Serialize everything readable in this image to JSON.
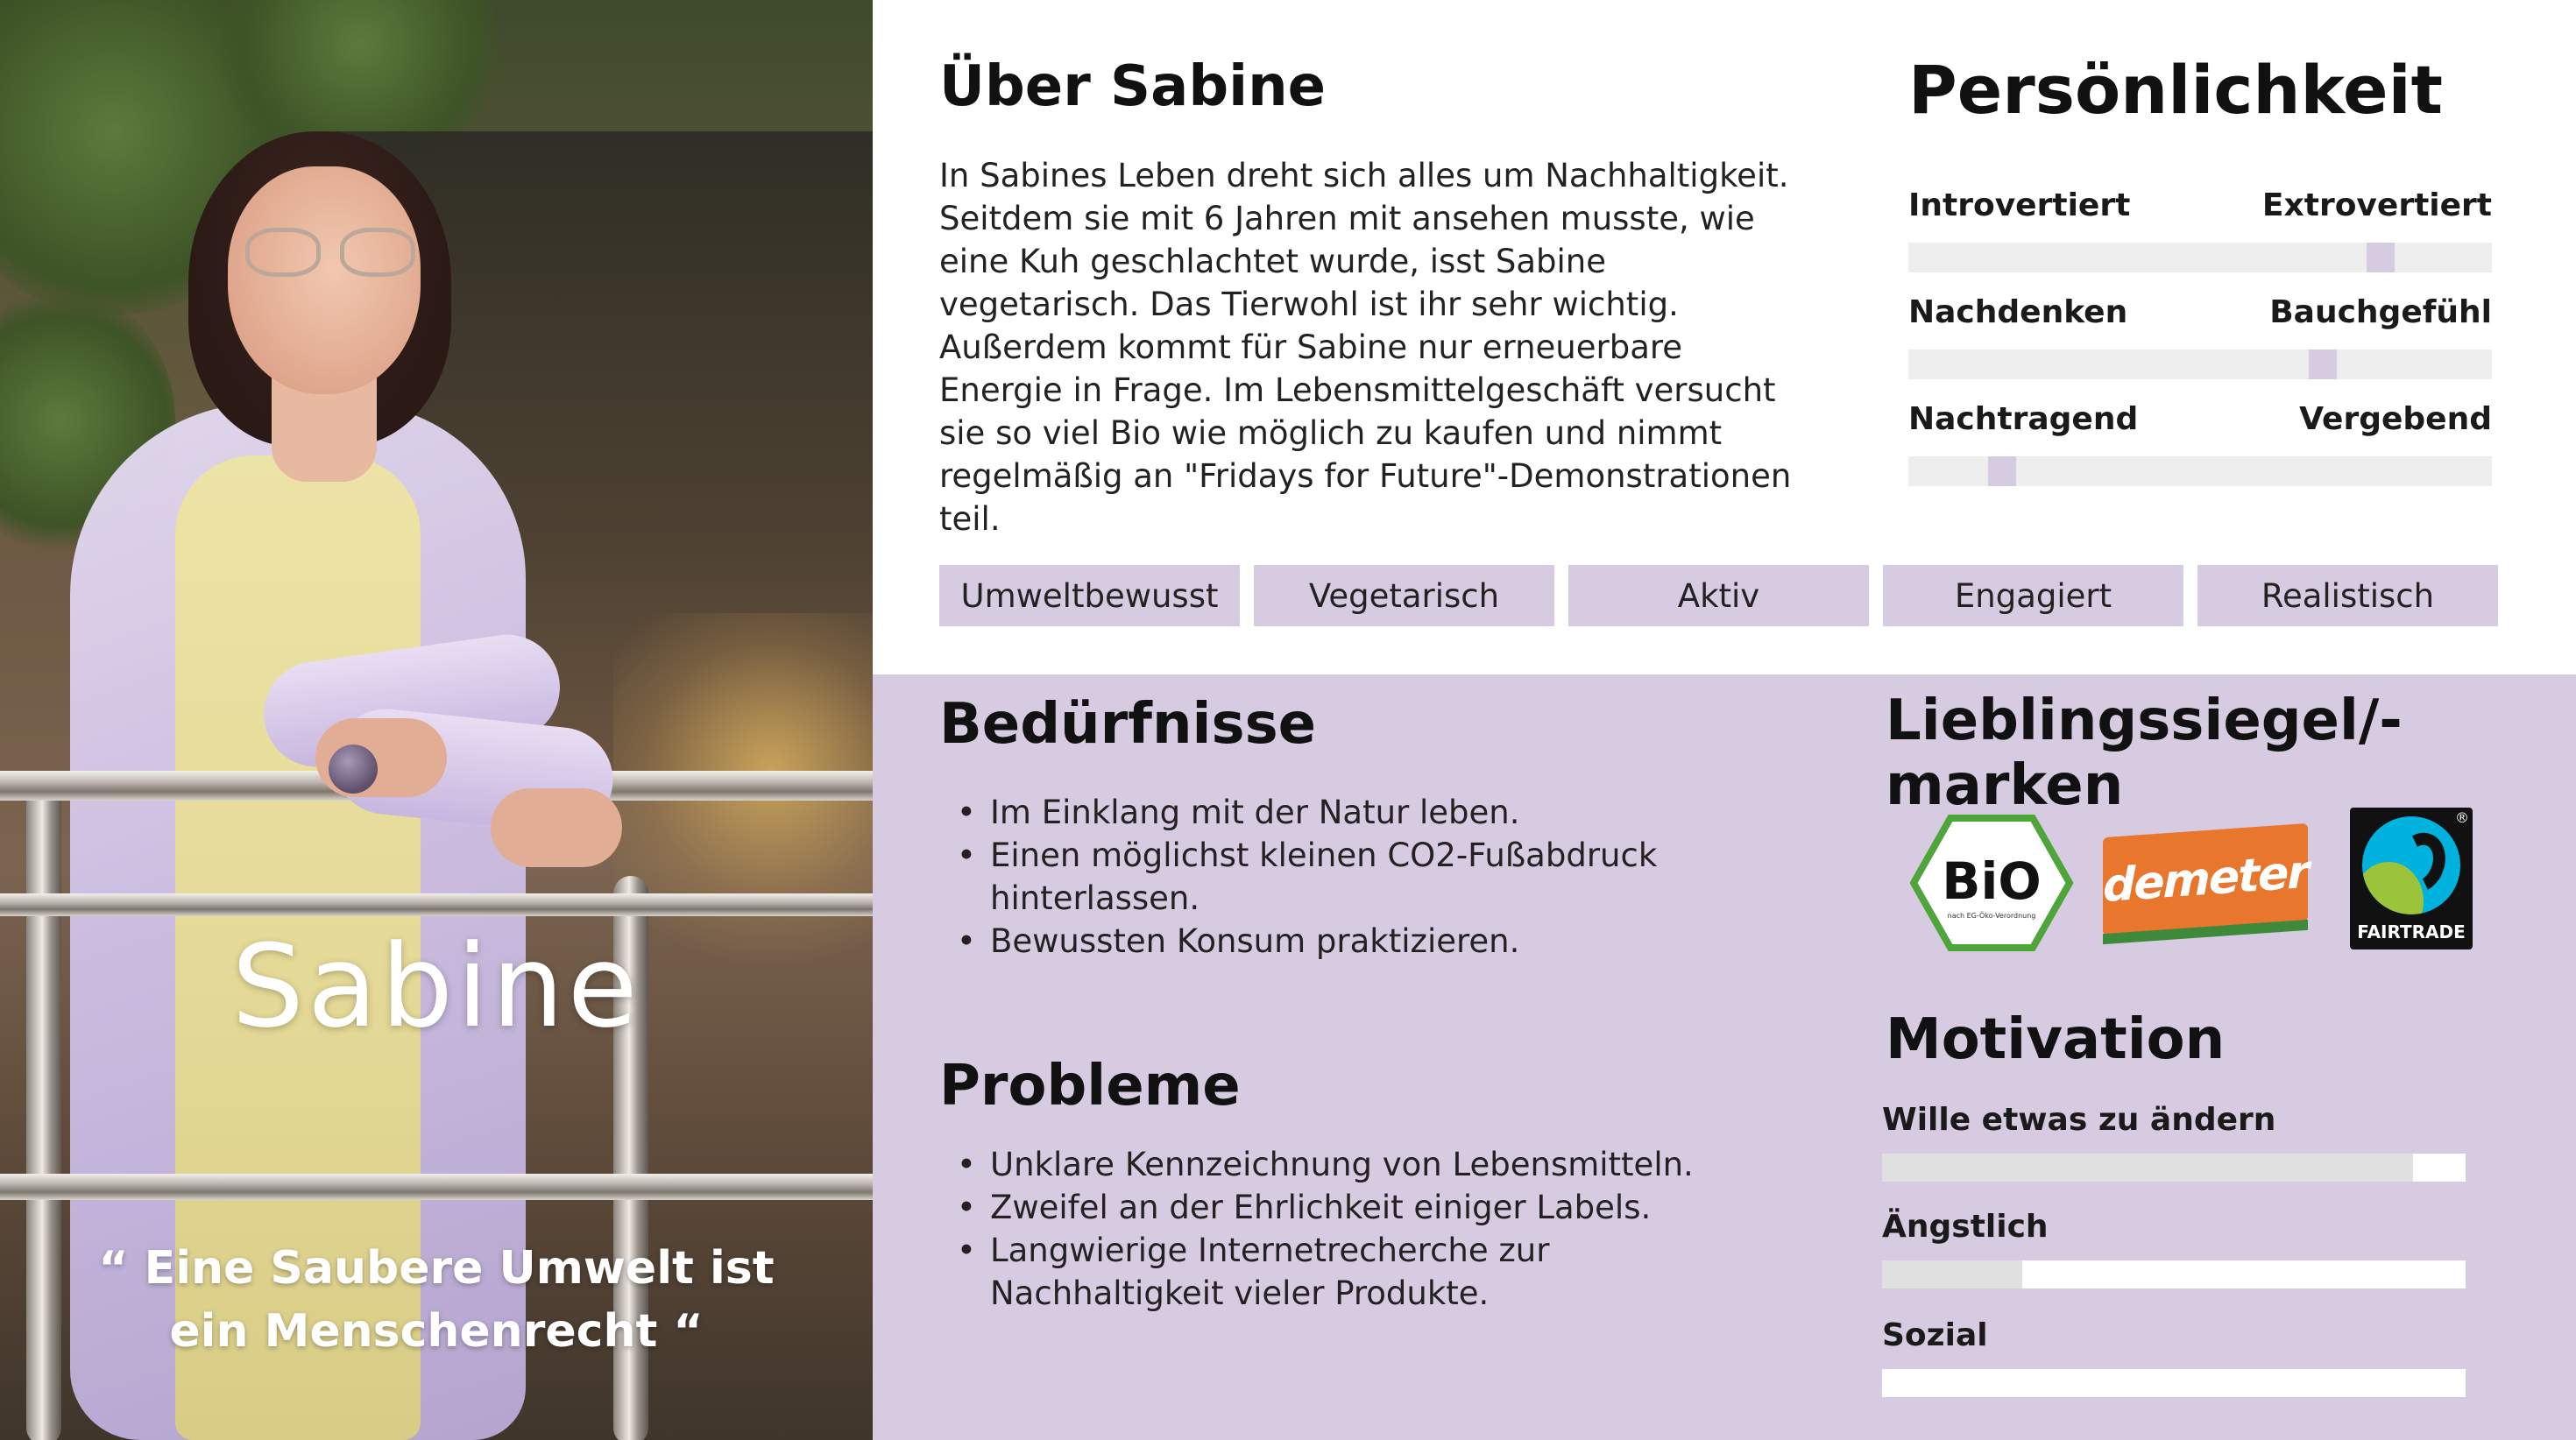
{
  "persona": {
    "name": "Sabine",
    "quote": "“ Eine Saubere Umwelt ist ein Menschenrecht “"
  },
  "about": {
    "title": "Über Sabine",
    "text": "In Sabines Leben dreht sich alles um Nachhaltigkeit. Seitdem sie mit 6 Jahren mit ansehen musste, wie eine Kuh geschlachtet wurde, isst Sabine vegetarisch. Das Tierwohl ist ihr sehr wichtig. Außerdem kommt für Sabine nur erneuerbare Energie in Frage. Im Lebensmittelgeschäft versucht sie so viel Bio wie möglich zu kaufen und nimmt regelmäßig an \"Fridays for Future\"-Demonstrationen teil."
  },
  "personality": {
    "title": "Persönlichkeit",
    "traits": [
      {
        "left": "Introvertiert",
        "right": "Extrovertiert",
        "value": 0.81
      },
      {
        "left": "Nachdenken",
        "right": "Bauchgefühl",
        "value": 0.71
      },
      {
        "left": "Nachtragend",
        "right": "Vergebend",
        "value": 0.16
      }
    ]
  },
  "tags": [
    "Umweltbewusst",
    "Vegetarisch",
    "Aktiv",
    "Engagiert",
    "Realistisch"
  ],
  "needs": {
    "title": "Bedürfnisse",
    "items": [
      "Im Einklang mit der Natur leben.",
      "Einen möglichst kleinen CO2-Fußabdruck hinterlassen.",
      "Bewussten Konsum praktizieren."
    ]
  },
  "problems": {
    "title": "Probleme",
    "items": [
      "Unklare Kennzeichnung von Lebensmitteln.",
      "Zweifel an der Ehrlichkeit einiger Labels.",
      "Langwierige Internetrecherche zur Nachhaltigkeit vieler Produkte."
    ]
  },
  "brands": {
    "title": "Lieblingssiegel/-marken",
    "logos": [
      {
        "name": "bio-siegel-logo",
        "text": "BiO",
        "subtext": "nach EG-Öko-Verordnung"
      },
      {
        "name": "demeter-logo",
        "text": "demeter"
      },
      {
        "name": "fairtrade-logo",
        "text": "FAIRTRADE"
      }
    ]
  },
  "motivation": {
    "title": "Motivation",
    "items": [
      {
        "label": "Wille etwas zu ändern",
        "value": 0.91
      },
      {
        "label": "Ängstlich",
        "value": 0.24
      },
      {
        "label": "Sozial",
        "value": 0.0
      }
    ]
  },
  "colors": {
    "accent_lavender": "#d6cbe1",
    "track_gray": "#eeeeee",
    "text_dark": "#1a1a1a"
  }
}
